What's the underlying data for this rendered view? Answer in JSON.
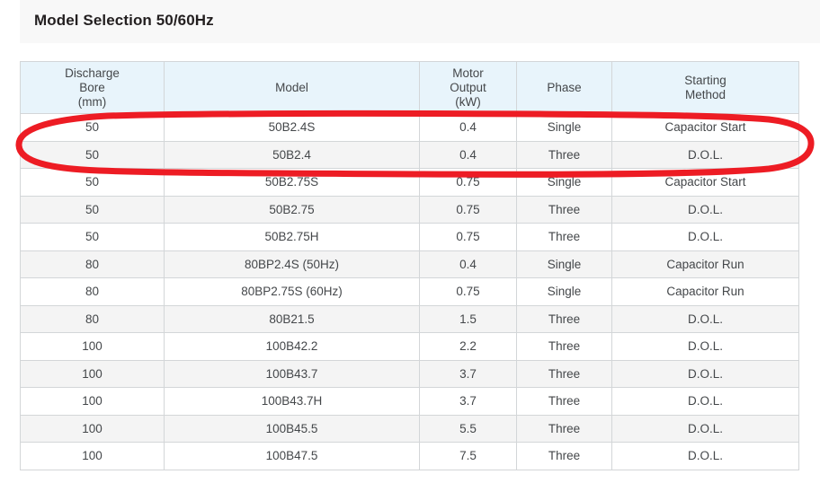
{
  "header": {
    "title": "Model Selection 50/60Hz"
  },
  "table": {
    "columns": [
      {
        "lines": [
          "Discharge",
          "Bore",
          "(mm)"
        ]
      },
      {
        "lines": [
          "Model"
        ]
      },
      {
        "lines": [
          "Motor",
          "Output",
          "(kW)"
        ]
      },
      {
        "lines": [
          "Phase"
        ]
      },
      {
        "lines": [
          "Starting",
          "Method"
        ]
      }
    ],
    "rows": [
      {
        "bore": "50",
        "model": "50B2.4S",
        "output": "0.4",
        "phase": "Single",
        "starting": "Capacitor Start",
        "highlighted": true
      },
      {
        "bore": "50",
        "model": "50B2.4",
        "output": "0.4",
        "phase": "Three",
        "starting": "D.O.L.",
        "highlighted": true
      },
      {
        "bore": "50",
        "model": "50B2.75S",
        "output": "0.75",
        "phase": "Single",
        "starting": "Capacitor Start",
        "highlighted": false
      },
      {
        "bore": "50",
        "model": "50B2.75",
        "output": "0.75",
        "phase": "Three",
        "starting": "D.O.L.",
        "highlighted": false
      },
      {
        "bore": "50",
        "model": "50B2.75H",
        "output": "0.75",
        "phase": "Three",
        "starting": "D.O.L.",
        "highlighted": false
      },
      {
        "bore": "80",
        "model": "80BP2.4S (50Hz)",
        "output": "0.4",
        "phase": "Single",
        "starting": "Capacitor Run",
        "highlighted": false
      },
      {
        "bore": "80",
        "model": "80BP2.75S (60Hz)",
        "output": "0.75",
        "phase": "Single",
        "starting": "Capacitor Run",
        "highlighted": false
      },
      {
        "bore": "80",
        "model": "80B21.5",
        "output": "1.5",
        "phase": "Three",
        "starting": "D.O.L.",
        "highlighted": false
      },
      {
        "bore": "100",
        "model": "100B42.2",
        "output": "2.2",
        "phase": "Three",
        "starting": "D.O.L.",
        "highlighted": false
      },
      {
        "bore": "100",
        "model": "100B43.7",
        "output": "3.7",
        "phase": "Three",
        "starting": "D.O.L.",
        "highlighted": false
      },
      {
        "bore": "100",
        "model": "100B43.7H",
        "output": "3.7",
        "phase": "Three",
        "starting": "D.O.L.",
        "highlighted": false
      },
      {
        "bore": "100",
        "model": "100B45.5",
        "output": "5.5",
        "phase": "Three",
        "starting": "D.O.L.",
        "highlighted": false
      },
      {
        "bore": "100",
        "model": "100B47.5",
        "output": "7.5",
        "phase": "Three",
        "starting": "D.O.L.",
        "highlighted": false
      }
    ]
  },
  "annotation": {
    "type": "hand-drawn-oval",
    "color": "#ed1c24",
    "stroke_width": 7,
    "covers_rows": [
      "50B2.4S",
      "50B2.4"
    ]
  },
  "colors": {
    "banner_background": "#f8f8f8",
    "header_cell_background": "#e8f4fb",
    "row_background": "#ffffff",
    "row_alt_background": "#f4f4f4",
    "border": "#d3d6d8",
    "text": "#44474a",
    "title_text": "#231f20",
    "annotation_red": "#ed1c24"
  }
}
